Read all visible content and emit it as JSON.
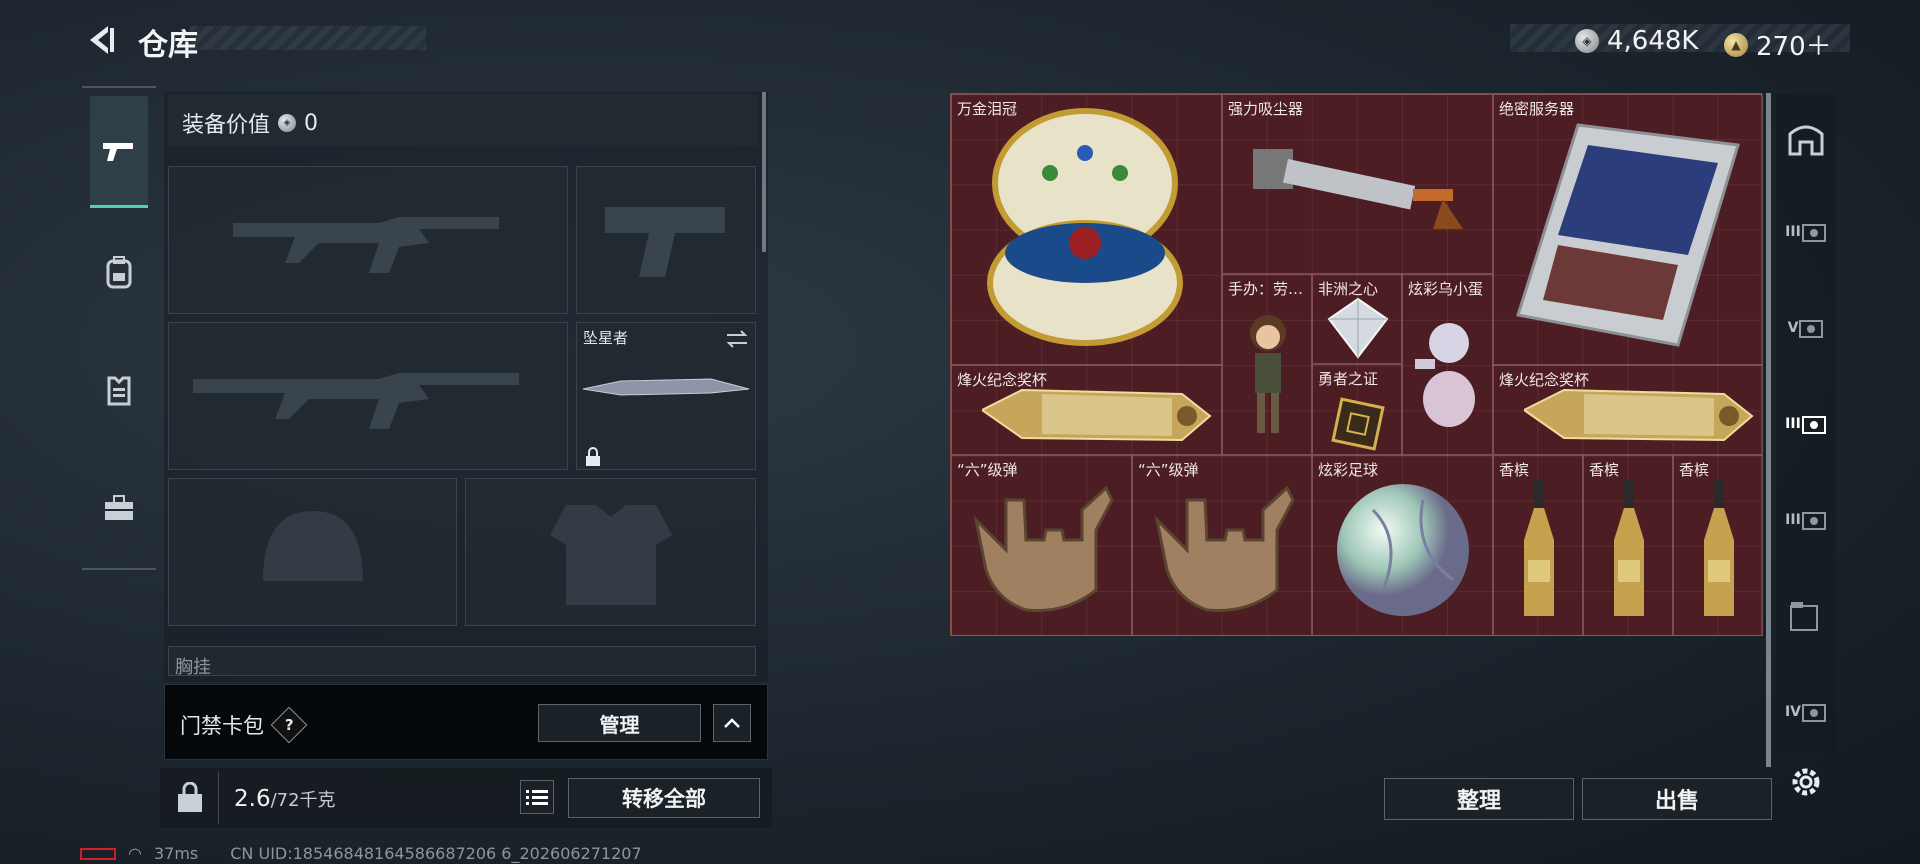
{
  "header": {
    "title": "仓库",
    "currency_silver": "4,648K",
    "currency_gold": "270＋",
    "version_hint": "···"
  },
  "left": {
    "tabs": [
      "weapon",
      "backpack",
      "armor",
      "toolbox"
    ],
    "equip_value_label": "装备价值",
    "equip_value": "0",
    "slots": {
      "melee_name": "坠星者",
      "chest_rig_label": "胸挂"
    },
    "keycard_label": "门禁卡包",
    "keycard_help": "?",
    "manage_label": "管理",
    "weight_current": "2.6",
    "weight_max": "/72千克",
    "transfer_all": "转移全部"
  },
  "grid": {
    "items": [
      {
        "name": "万金泪冠",
        "icon": "crown-egg"
      },
      {
        "name": "强力吸尘器",
        "icon": "vacuum"
      },
      {
        "name": "绝密服务器",
        "icon": "server"
      },
      {
        "name": "手办：劳…",
        "icon": "figurine"
      },
      {
        "name": "非洲之心",
        "icon": "diamond"
      },
      {
        "name": "炫彩乌小蛋",
        "icon": "egg-creature"
      },
      {
        "name": "烽火纪念奖杯",
        "icon": "trophy"
      },
      {
        "name": "勇者之证",
        "icon": "badge"
      },
      {
        "name": "烽火纪念奖杯",
        "icon": "trophy"
      },
      {
        "name": "“六”级弹",
        "icon": "ammo-hand"
      },
      {
        "name": "“六”级弹",
        "icon": "ammo-hand"
      },
      {
        "name": "炫彩足球",
        "icon": "football"
      },
      {
        "name": "香槟",
        "icon": "champagne"
      },
      {
        "name": "香槟",
        "icon": "champagne"
      },
      {
        "name": "香槟",
        "icon": "champagne"
      }
    ],
    "tidy_label": "整理",
    "sell_label": "出售"
  },
  "right_tabs": [
    "safe-box",
    "III",
    "V",
    "III",
    "III",
    "storage",
    "IV",
    "settings"
  ],
  "status": {
    "ping": "37ms",
    "uid": "CN UID:18546848164586687206 6_202606271207"
  },
  "colors": {
    "accent": "#4fd1b7",
    "grid_bg": "#4a1e22"
  }
}
